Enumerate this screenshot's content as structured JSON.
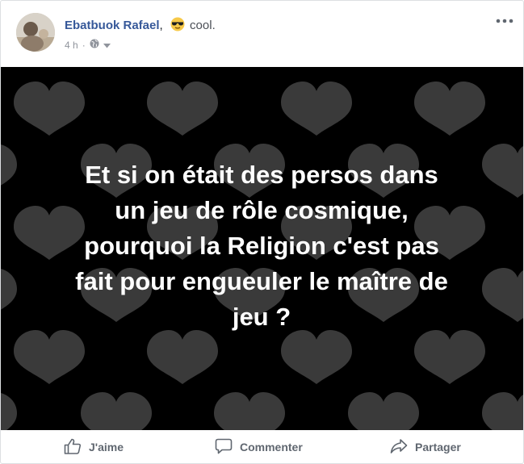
{
  "post": {
    "author": "Ebatbuok Rafael",
    "separator": ",",
    "feeling": "cool.",
    "feeling_icon": "sunglasses-emoji-icon",
    "timestamp": "4 h",
    "meta_dot": "·",
    "privacy_icon": "globe-icon",
    "text_lines": [
      "Et si on était des persos dans",
      "un jeu de rôle cosmique,",
      "pourquoi la Religion c'est pas",
      "fait pour engueuler le maître de",
      "jeu ?"
    ]
  },
  "actions": {
    "like": "J'aime",
    "comment": "Commenter",
    "share": "Partager"
  },
  "colors": {
    "author": "#365899",
    "action_text": "#606770",
    "post_background": "#000000",
    "hearts": "#3a3a3a"
  }
}
